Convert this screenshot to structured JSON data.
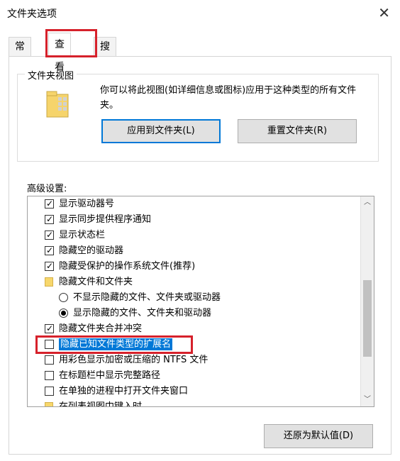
{
  "window": {
    "title": "文件夹选项",
    "close_icon": "close-icon"
  },
  "tabs": [
    {
      "label": "常规"
    },
    {
      "label": "查看"
    },
    {
      "label": "搜索"
    }
  ],
  "folder_views": {
    "title": "文件夹视图",
    "description": "你可以将此视图(如详细信息或图标)应用于这种类型的所有文件夹。",
    "apply_button": "应用到文件夹(L)",
    "reset_button": "重置文件夹(R)"
  },
  "advanced": {
    "label": "高级设置:",
    "items": [
      {
        "type": "checkbox",
        "checked": true,
        "label": "显示驱动器号"
      },
      {
        "type": "checkbox",
        "checked": true,
        "label": "显示同步提供程序通知"
      },
      {
        "type": "checkbox",
        "checked": true,
        "label": "显示状态栏"
      },
      {
        "type": "checkbox",
        "checked": true,
        "label": "隐藏空的驱动器"
      },
      {
        "type": "checkbox",
        "checked": true,
        "label": "隐藏受保护的操作系统文件(推荐)"
      },
      {
        "type": "folder",
        "label": "隐藏文件和文件夹"
      },
      {
        "type": "radio",
        "checked": false,
        "label": "不显示隐藏的文件、文件夹或驱动器"
      },
      {
        "type": "radio",
        "checked": true,
        "label": "显示隐藏的文件、文件夹和驱动器"
      },
      {
        "type": "checkbox",
        "checked": true,
        "label": "隐藏文件夹合并冲突"
      },
      {
        "type": "checkbox",
        "checked": false,
        "label": "隐藏已知文件类型的扩展名"
      },
      {
        "type": "checkbox",
        "checked": false,
        "label": "用彩色显示加密或压缩的 NTFS 文件"
      },
      {
        "type": "checkbox",
        "checked": false,
        "label": "在标题栏中显示完整路径"
      },
      {
        "type": "checkbox",
        "checked": false,
        "label": "在单独的进程中打开文件夹窗口"
      },
      {
        "type": "folder",
        "label": "在列表视图中键入时"
      }
    ]
  },
  "restore_button": "还原为默认值(D)",
  "colors": {
    "accent": "#0078d7",
    "highlight_box": "#d6212b"
  }
}
